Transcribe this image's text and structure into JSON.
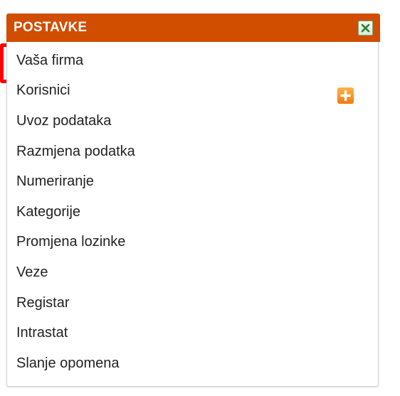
{
  "panel": {
    "title": "POSTAVKE",
    "header_color": "#d14d00",
    "close_icon": "close-icon"
  },
  "menu": {
    "items": [
      {
        "label": "Vaša firma",
        "highlighted": true
      },
      {
        "label": "Korisnici",
        "action_icon": "add-icon"
      },
      {
        "label": "Uvoz podataka"
      },
      {
        "label": "Razmjena podatka"
      },
      {
        "label": "Numeriranje"
      },
      {
        "label": "Kategorije"
      },
      {
        "label": "Promjena lozinke"
      },
      {
        "label": "Veze"
      },
      {
        "label": "Registar"
      },
      {
        "label": "Intrastat"
      },
      {
        "label": "Slanje opomena"
      }
    ]
  },
  "colors": {
    "highlight": "#ff0000",
    "add_icon": "#f28a1e",
    "close_icon": "#2e7d32"
  }
}
